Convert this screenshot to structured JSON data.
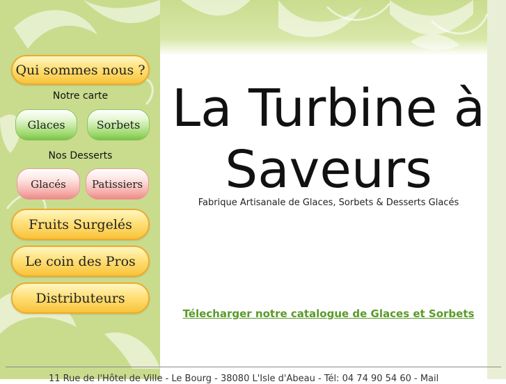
{
  "nav": {
    "about_label": "Qui sommes nous ?",
    "menu_heading": "Notre carte",
    "glaces_label": "Glaces",
    "sorbets_label": "Sorbets",
    "desserts_heading": "Nos Desserts",
    "desserts_glaces_label": "Glacés",
    "patissiers_label": "Patissiers",
    "fruits_label": "Fruits Surgelés",
    "pros_label": "Le coin des Pros",
    "distributeurs_label": "Distributeurs"
  },
  "main": {
    "title_line1": "La Turbine à",
    "title_line2": "Saveurs",
    "tagline": "Fabrique Artisanale de Glaces, Sorbets &  Desserts Glacés",
    "catalogue_link": "Télecharger notre catalogue de Glaces et Sorbets"
  },
  "footer": {
    "address": "11 Rue de l'Hôtel de Ville - Le Bourg - 38080 L'Isle d'Abeau - Tél: 04 74 90 54 60 - Mail"
  },
  "colors": {
    "background_green": "#c9dc8e",
    "button_orange": "#f8c43a",
    "button_green": "#7cc24c",
    "button_red": "#ea8a86",
    "link_green": "#5a9a2a"
  }
}
